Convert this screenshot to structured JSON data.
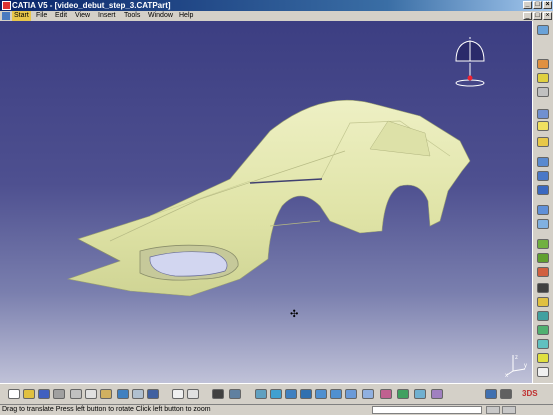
{
  "window": {
    "title": "CATIA V5 - [video_debut_step_3.CATPart]"
  },
  "menu": [
    "Start",
    "File",
    "Edit",
    "View",
    "Insert",
    "Tools",
    "Window",
    "Help"
  ],
  "status": {
    "message": "Drag to translate  Press left button to rotate  Click left button to zoom"
  },
  "axis": {
    "x": "x",
    "y": "y",
    "z": "z"
  },
  "colors": {
    "titlebar": "#0a246a",
    "viewport_top": "#3c3e82",
    "part_surface": "#e8ebb6"
  },
  "icons": {
    "right_toolbar": [
      "sketcher-icon",
      "point-icon",
      "line-icon",
      "plane-icon",
      "extrude-icon",
      "offset-icon",
      "revolve-icon",
      "sphere-icon",
      "cylinder-icon",
      "sweep-icon",
      "fill-icon",
      "loft-icon",
      "blend-icon",
      "join-icon",
      "healing-icon",
      "split-icon",
      "trim-icon",
      "boundary-icon",
      "extract-icon",
      "fillet-icon",
      "translate-icon",
      "rotate-icon",
      "symmetry-icon",
      "scaling-icon",
      "affinity-icon"
    ],
    "bottom_toolbar": [
      "new-icon",
      "open-icon",
      "save-icon",
      "print-icon",
      "cut-icon",
      "copy-icon",
      "paste-icon",
      "undo-icon",
      "redo-icon",
      "whats-this-icon",
      "formula-icon",
      "comment-icon",
      "table-icon",
      "knowledge-icon",
      "fly-mode-icon",
      "fit-all-icon",
      "pan-icon",
      "rotate-view-icon",
      "zoom-in-icon",
      "zoom-out-icon",
      "normal-view-icon",
      "iso-view-icon",
      "render-style-icon",
      "hide-show-icon",
      "swap-space-icon",
      "apply-material-icon",
      "catalog-icon",
      "measure-icon"
    ]
  }
}
